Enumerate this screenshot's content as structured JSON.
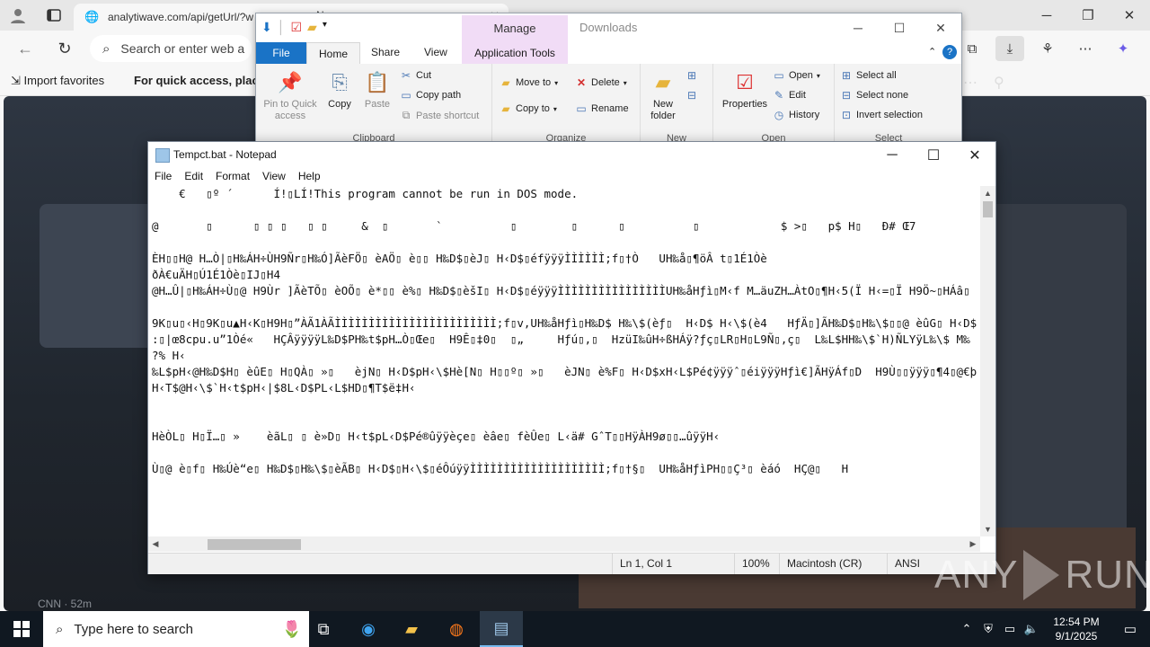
{
  "browser": {
    "url": "analytiwave.com/api/getUrl/?w",
    "tab_title": "N",
    "search_placeholder": "Search or enter web a",
    "favorites": [
      {
        "label": "Import favorites"
      },
      {
        "label": "For quick access, place yo"
      }
    ],
    "news_source": "CNN · 52m"
  },
  "explorer": {
    "title": "Downloads",
    "contextual_tab": "Manage",
    "tabs": {
      "file": "File",
      "home": "Home",
      "share": "Share",
      "view": "View",
      "app_tools": "Application Tools"
    },
    "clipboard": {
      "label": "Clipboard",
      "pin": "Pin to Quick access",
      "copy": "Copy",
      "paste": "Paste",
      "cut": "Cut",
      "copy_path": "Copy path",
      "paste_shortcut": "Paste shortcut"
    },
    "organize": {
      "label": "Organize",
      "move_to": "Move to",
      "copy_to": "Copy to",
      "delete": "Delete",
      "rename": "Rename"
    },
    "new": {
      "label": "New",
      "new_folder": "New folder"
    },
    "open": {
      "label": "Open",
      "properties": "Properties",
      "open": "Open",
      "edit": "Edit",
      "history": "History"
    },
    "select": {
      "label": "Select",
      "select_all": "Select all",
      "select_none": "Select none",
      "invert": "Invert selection"
    }
  },
  "notepad": {
    "title": "Tempct.bat - Notepad",
    "menu": [
      "File",
      "Edit",
      "Format",
      "View",
      "Help"
    ],
    "content": "    €   ▯º ´      Í!▯LÍ!This program cannot be run in DOS mode.\n\n@       ▯      ▯ ▯ ▯   ▯ ▯     &  ▯       `          ▯        ▯      ▯          ▯            $ >▯   p$ H▯   Ð# Œ7\n\nÈH▯▯H@ H…Ò|▯H‰ÁH÷ÙH9Ñr▯H‰Ó]ÃèFÖ▯ èAÖ▯ è▯▯ H‰D$▯èJ▯ H‹D$▯éfÿÿÿÌÌÌÌÌÌ;f▯†Ò   UH‰å▯¶öÂ t▯1É1Òè\nðÀ€uÄH▯Ú1É1Òè▯IJ▯H4\n@H…Û|▯H‰ÁH÷Ù▯@ H9Ùr ]ÃèTÕ▯ èOÕ▯ è*▯▯ è%▯ H‰D$▯èšI▯ H‹D$▯éÿÿÿÌÌÌÌÌÌÌÌÌÌÌÌÌÌÌÌUH‰åHƒì▯M‹f M…äuZH…ÀtO▯¶H‹5(Ï H‹=▯Ï H9Ö~▯HÁâ▯\n\n9K▯u▯‹H▯9K▯u▲H‹K▯H9H▯”ÀÃ1ÀÃÌÌÌÌÌÌÌÌÌÌÌÌÌÌÌÌÌÌÌÌÌÌÌÌ;f▯v,UH‰åHƒì▯H‰D$ H‰\\$(èƒ▯  H‹D$ H‹\\$(è4   HƒÄ▯]ÃH‰D$▯H‰\\$▯▯@ èûG▯ H‹D$\n:▯|œ8cpu.u”1Òé«   HÇÂÿÿÿÿL‰D$PH‰t$pH…Ò▯Œe▯  H9Ê▯‡0▯  ▯„     Hƒú▯,▯  HzüI‰ûH÷ßHÁÿ?ƒç▯LR▯H▯L9Ñ▯,ç▯  L‰L$HH‰\\$`H)ÑLYÿL‰\\$ M‰\n?% H‹\n‰L$pH‹@H‰D$H▯ èûE▯ H▯QÀ▯ »▯   èjN▯ H‹D$pH‹\\$Hè[N▯ H▯▯º▯ »▯   èJN▯ è%F▯ H‹D$xH‹L$Pé¢ÿÿÿˆ▯éiÿÿÿHƒì€]ÃHÿÁf▯D  H9Ù▯▯ÿÿÿ▯¶4▯@€þ\nH‹T$@H‹\\$`H‹t$pH‹|$8L‹D$PL‹L$HD▯¶T$ë‡H‹\n\n\nHèÒL▯ H▯Ï…▯ »    èãL▯ ▯ è»D▯ H‹t$pL‹D$Pé®ûÿÿèçe▯ èâe▯ fèÛe▯ L‹ä# GˆT▯▯HÿÀH9ø▯▯…ûÿÿH‹\n\nÙ▯@ è▯f▯ H‰Úè“e▯ H‰D$▯H‰\\$▯èÃB▯ H‹D$▯H‹\\$▯éÔúÿÿÌÌÌÌÌÌÌÌÌÌÌÌÌÌÌÌÌÌÌÌ;f▯†§▯  UH‰åHƒìPH▯▯Ç³▯ èáó  HÇ@▯   H",
    "status": {
      "position": "Ln 1, Col 1",
      "zoom": "100%",
      "line_ending": "Macintosh (CR)",
      "encoding": "ANSI"
    }
  },
  "watermark": {
    "left": "ANY",
    "right": "RUN"
  },
  "taskbar": {
    "search_placeholder": "Type here to search",
    "time": "12:54 PM",
    "date": "9/1/2025"
  }
}
